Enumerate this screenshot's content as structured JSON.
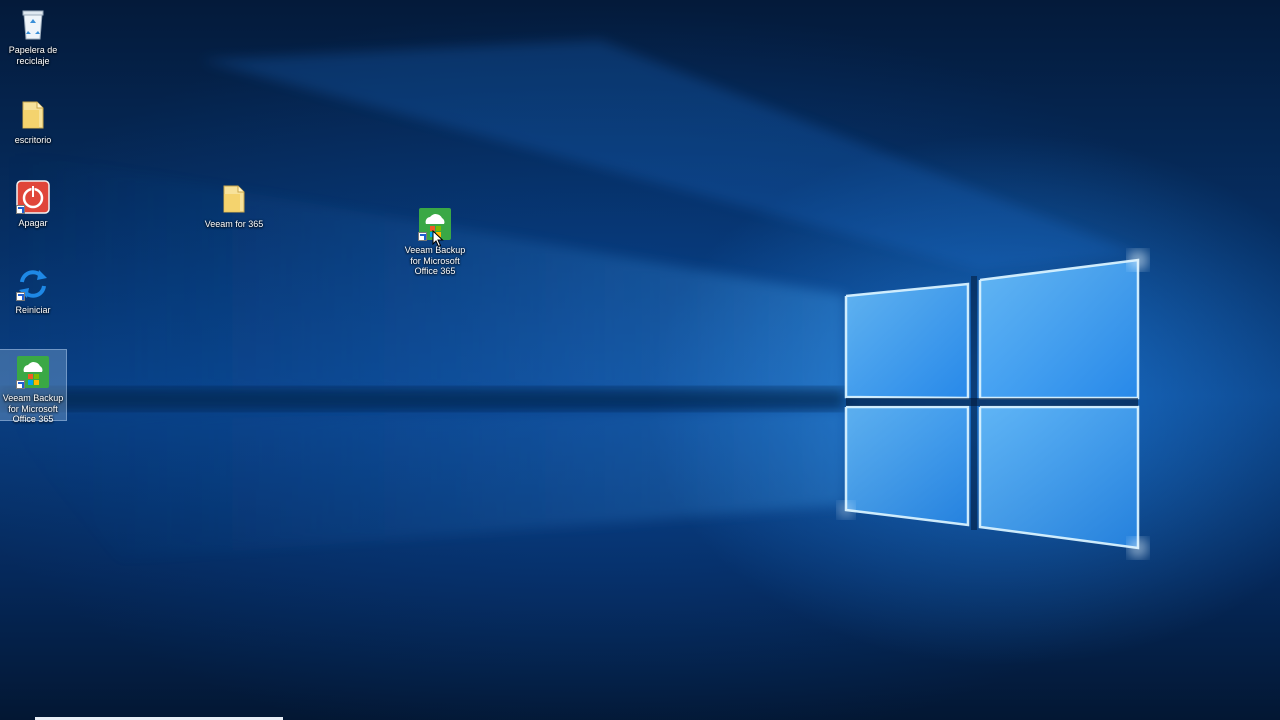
{
  "desktop": {
    "icons": [
      {
        "id": "recycle-bin",
        "label": "Papelera de reciclaje",
        "icon": "recycle-bin-icon"
      },
      {
        "id": "escritorio",
        "label": "escritorio",
        "icon": "folder-icon"
      },
      {
        "id": "apagar",
        "label": "Apagar",
        "icon": "power-icon"
      },
      {
        "id": "reiniciar",
        "label": "Reiniciar",
        "icon": "restart-icon"
      },
      {
        "id": "veeam-backup-left",
        "label": "Veeam Backup for Microsoft Office 365",
        "icon": "veeam-backup-icon",
        "selected": true
      },
      {
        "id": "veeam-for-365",
        "label": "Veeam for 365",
        "icon": "folder-icon"
      },
      {
        "id": "veeam-backup-center",
        "label": "Veeam Backup for Microsoft Office 365",
        "icon": "veeam-backup-icon"
      }
    ]
  },
  "colors": {
    "wallpaper_dark": "#031733",
    "wallpaper_glow": "#2896ff",
    "folder": "#f3d57a",
    "power": "#e0463a",
    "restart": "#1e88e5",
    "veeam_green": "#3aa845"
  }
}
